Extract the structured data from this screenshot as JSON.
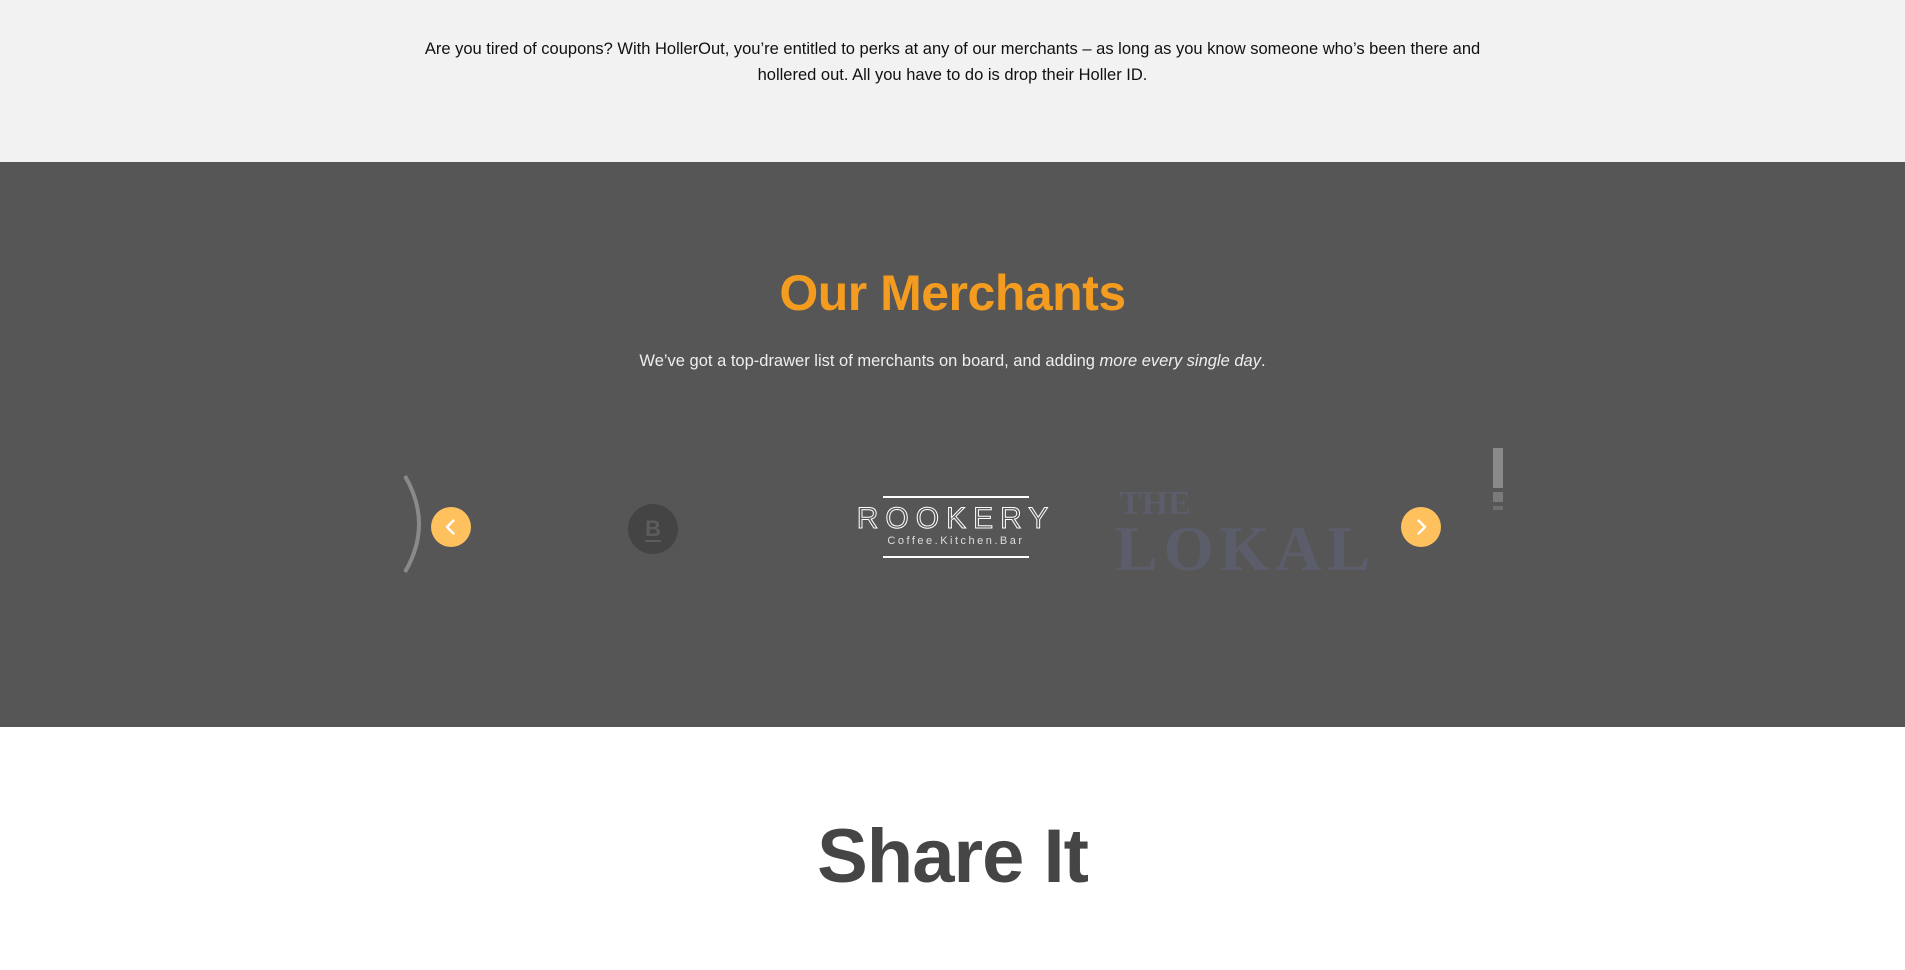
{
  "intro": {
    "text": "Are you tired of coupons? With HollerOut, you’re entitled to perks at any of our merchants – as long as you know someone who’s been there and hollered out. All you have to do is drop their Holler ID."
  },
  "merchants": {
    "title": "Our Merchants",
    "subtitle_lead": "We’ve got a top-drawer list of merchants on board, and adding ",
    "subtitle_emphasis": "more every single day",
    "subtitle_tail": ".",
    "logos": {
      "rookery": {
        "name": "ROOKERY",
        "tagline": "Coffee.Kitchen.Bar"
      },
      "lokal": {
        "line1": "THE",
        "line2": "LOKAL"
      },
      "b_logo": {
        "letter": "B"
      }
    },
    "prev_icon": "chevron-left-icon",
    "next_icon": "chevron-right-icon"
  },
  "share": {
    "title": "Share It"
  },
  "colors": {
    "accent_orange": "#f39c1f",
    "arrow_yellow": "#ffc15e",
    "dark_band": "#565656",
    "light_band": "#f2f2f2"
  }
}
